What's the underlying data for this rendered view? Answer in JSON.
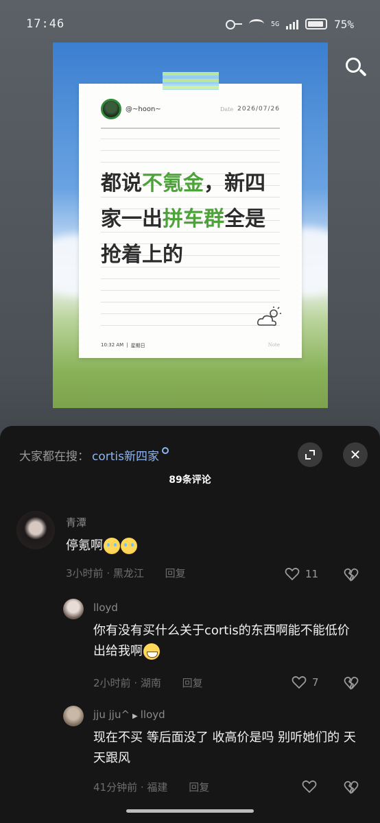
{
  "status_bar": {
    "time": "17:46",
    "network": "5G",
    "battery": "75%"
  },
  "post": {
    "handle": "@~hoon~",
    "date_label": "Date",
    "date": "2026/07/26",
    "text_parts": [
      {
        "text": "都说",
        "highlight": false
      },
      {
        "text": "不氪金",
        "highlight": true
      },
      {
        "text": "，新四家一出",
        "highlight": false
      },
      {
        "text": "拼车群",
        "highlight": true
      },
      {
        "text": "全是抢着上的",
        "highlight": false
      }
    ],
    "weather_icon": "cloud-sun-icon",
    "footer_time": "10:32 AM",
    "footer_sep": "|",
    "footer_day": "星期日",
    "footer_note": "Note",
    "highlight_color": "#4ea23c"
  },
  "sheet": {
    "hot_search_label": "大家都在搜：",
    "hot_search_term": "cortis新四家",
    "comment_count": "89条评论"
  },
  "comments": [
    {
      "name": "青潭",
      "reply_to": "",
      "text": "停氪啊",
      "emojis": [
        "cry",
        "cry"
      ],
      "time": "3小时前",
      "location": "黑龙江",
      "reply_label": "回复",
      "likes": "11"
    },
    {
      "name": "lloyd",
      "reply_to": "",
      "text": "你有没有买什么关于cortis的东西啊能不能低价出给我啊",
      "emojis": [
        "grin"
      ],
      "time": "2小时前",
      "location": "湖南",
      "reply_label": "回复",
      "likes": "7"
    },
    {
      "name": "jju jju^",
      "reply_to": "lloyd",
      "text": "现在不买 等后面没了 收高价是吗 别听她们的 天天跟风",
      "emojis": [],
      "time": "41分钟前",
      "location": "福建",
      "reply_label": "回复",
      "likes": ""
    }
  ],
  "colors": {
    "sheet_bg": "#161616",
    "link_blue": "#8fb6f0",
    "meta_gray": "#6e6e6e"
  }
}
